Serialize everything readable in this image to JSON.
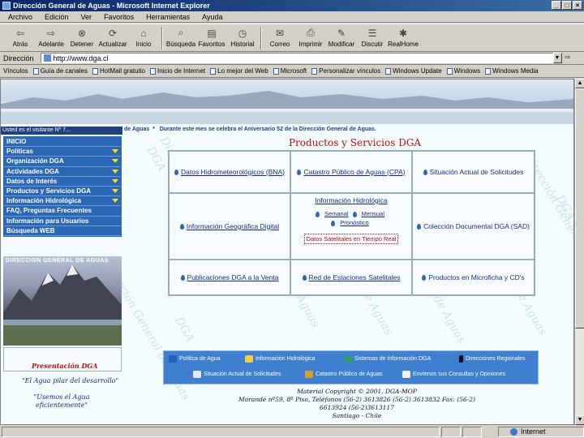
{
  "window": {
    "title": "Dirección General de Aguas - Microsoft Internet Explorer",
    "controls": [
      "_",
      "□",
      "×"
    ]
  },
  "menu": [
    "Archivo",
    "Edición",
    "Ver",
    "Favoritos",
    "Herramientas",
    "Ayuda"
  ],
  "toolbar": [
    {
      "label": "Atrás",
      "icon": "back-arrow-icon"
    },
    {
      "label": "Adelante",
      "icon": "forward-arrow-icon"
    },
    {
      "label": "Detener",
      "icon": "stop-icon"
    },
    {
      "label": "Actualizar",
      "icon": "refresh-icon"
    },
    {
      "label": "Inicio",
      "icon": "home-icon"
    },
    {
      "label": "Búsqueda",
      "icon": "search-icon"
    },
    {
      "label": "Favoritos",
      "icon": "favorites-icon"
    },
    {
      "label": "Historial",
      "icon": "history-icon"
    },
    {
      "label": "Correo",
      "icon": "mail-icon"
    },
    {
      "label": "Imprimir",
      "icon": "print-icon"
    },
    {
      "label": "Modificar",
      "icon": "edit-icon"
    },
    {
      "label": "Discutir",
      "icon": "discuss-icon"
    },
    {
      "label": "RealHome",
      "icon": "realhome-icon"
    }
  ],
  "address": {
    "label": "Dirección",
    "url": "http://www.dga.cl"
  },
  "links": {
    "label": "Vínculos",
    "items": [
      "Guía de canales",
      "HotMail gratuito",
      "Inicio de Internet",
      "Lo mejor del Web",
      "Microsoft",
      "Personalizar vínculos",
      "Windows Update",
      "Windows",
      "Windows Media"
    ]
  },
  "page": {
    "visit_counter": "Usted es el visitante Nº 7...",
    "ticker_prefix": "de Aguas",
    "ticker": "Durante este mes se celebra el Aniversario 52 de la Dirección General de Aguas.",
    "watermark": "Dirección General de Aguas",
    "watermark_short": "DGA",
    "side_menu": [
      {
        "label": "INICIO",
        "has_arrow": false
      },
      {
        "label": "Políticas",
        "has_arrow": true
      },
      {
        "label": "Organización DGA",
        "has_arrow": true
      },
      {
        "label": "Actividades DGA",
        "has_arrow": true
      },
      {
        "label": "Datos de Interés",
        "has_arrow": true
      },
      {
        "label": "Productos y Servicios DGA",
        "has_arrow": true
      },
      {
        "label": "Información Hidrológica",
        "has_arrow": true
      },
      {
        "label": "FAQ, Preguntas Frecuentes",
        "has_arrow": false
      },
      {
        "label": "Información para Usuarios",
        "has_arrow": false
      },
      {
        "label": "Búsqueda WEB",
        "has_arrow": false
      }
    ],
    "photo_title": "DIRECCION GENERAL DE AGUAS",
    "presentation": "Presentación DGA",
    "slogan1": "\"El Agua pilar del desarrollo\"",
    "slogan2": "\"Usemos el Agua eficientemente\"",
    "heading": "Productos y Servicios DGA",
    "products": {
      "bna": "Datos Hidrometeorológicos (BNA)",
      "cpa": "Catastro Público de Aguas (CPA)",
      "solicitudes": "Situación Actual de Solicitudes",
      "hidro_title": "Información Hidrológica",
      "semanal": "Semanal",
      "mensual": "Mensual",
      "pronostico": "Pronóstico",
      "tiempo_real": "Datos Satelitales en Tiempo Real",
      "geografica": "Información Geográfica Digital",
      "sad": "Colección Documental DGA (SAD)",
      "publicaciones": "Publicaciones DGA a la Venta",
      "estaciones": "Red de Estaciones Satelitales",
      "microficha": "Productos en Microficha y CD's"
    },
    "bottom_links": [
      "Política de Agua",
      "Información Hidrológica",
      "Sistemas de Información DGA",
      "Direcciones Regionales",
      "Situación Actual de Solicitudes",
      "Catastro Público de Aguas",
      "Envíenos sus Consultas y Opiniones"
    ],
    "footer": [
      "Material Copyright © 2001. DGA-MOP",
      "Morandé nº59, 8º Piso, Teléfonos (56-2) 3613826 (56-2) 3613832 Fax: (56-2)",
      "6613924 (56-2)3613117",
      "Santiago - Chile"
    ]
  },
  "status": {
    "zone": "Internet"
  },
  "colors": {
    "menu_blue": "#2b67b5",
    "accent_red": "#b01010",
    "link_blue": "#1a2a80",
    "arrow_yellow": "#ffe000"
  }
}
